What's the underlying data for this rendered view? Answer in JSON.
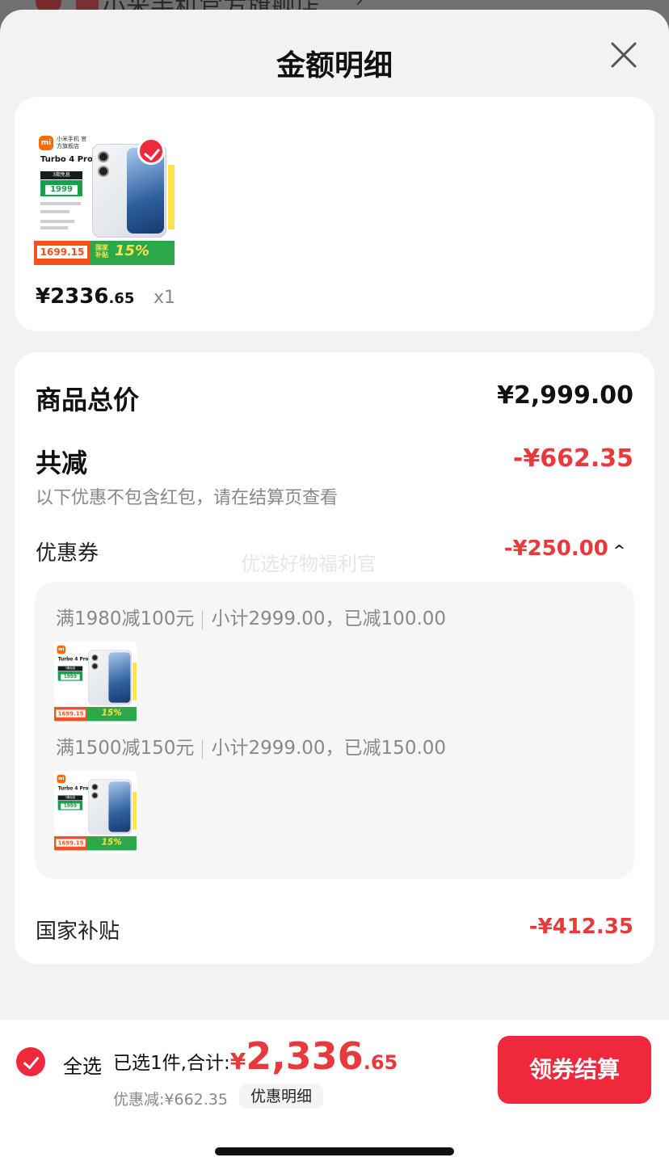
{
  "background": {
    "store_name": "小米手机官方旗舰店",
    "arrow": "›"
  },
  "sheet": {
    "title": "金额明细",
    "close_icon": "close-icon"
  },
  "product": {
    "price_int": "¥2336",
    "price_dec": ".65",
    "quantity": "x1",
    "thumb": {
      "logo": "mi",
      "store": "小米手机 官方旗舰店",
      "model": "Turbo 4 Pro",
      "tag": "3期免息",
      "price": "1999",
      "subsidy_price": "1699.15",
      "subsidy_label": "国家 补贴",
      "subsidy_pct": "15%"
    }
  },
  "detail": {
    "total_label": "商品总价",
    "total_value": "¥2,999.00",
    "reduce_label": "共减",
    "reduce_value": "-¥662.35",
    "reduce_note": "以下优惠不包含红包，请在结算页查看",
    "coupon_label": "优惠券",
    "coupon_value": "-¥250.00",
    "coupon_chevron": "^",
    "watermark": "优选好物福利官",
    "coupons": [
      {
        "rule": "满1980减100元",
        "summary": "小计2999.00，已减100.00"
      },
      {
        "rule": "满1500减150元",
        "summary": "小计2999.00，已减150.00"
      }
    ],
    "subsidy_label": "国家补贴",
    "subsidy_value": "-¥412.35"
  },
  "bottom": {
    "select_all": "全选",
    "selected_text": "已选1件,合计:",
    "currency": "¥",
    "total_int": "2,336",
    "total_dec": ".65",
    "discount_text": "优惠减:¥662.35",
    "detail_link": "优惠明细",
    "checkout": "领券结算"
  },
  "colors": {
    "accent": "#f0283c",
    "price_red": "#e83a3a",
    "sheet_bg": "#f2f2f2"
  }
}
